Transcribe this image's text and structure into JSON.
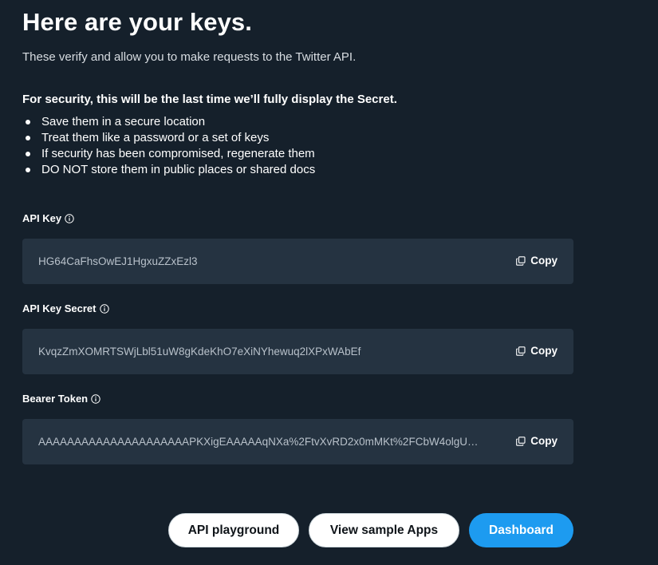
{
  "header": {
    "title": "Here are your keys.",
    "subtitle": "These verify and allow you to make requests to the Twitter API."
  },
  "security": {
    "heading": "For security, this will be the last time we’ll fully display the Secret.",
    "tips": [
      "Save them in a secure location",
      "Treat them like a password or a set of keys",
      "If security has been compromised, regenerate them",
      "DO NOT store them in public places or shared docs"
    ]
  },
  "keys": [
    {
      "label": "API Key",
      "value": "HG64CaFhsOwEJ1HgxuZZxEzl3",
      "copy_label": "Copy"
    },
    {
      "label": "API Key Secret",
      "value": "KvqzZmXOMRTSWjLbl51uW8gKdeKhO7eXiNYhewuq2lXPxWAbEf",
      "copy_label": "Copy"
    },
    {
      "label": "Bearer Token",
      "value": "AAAAAAAAAAAAAAAAAAAAAPKXigEAAAAAqNXa%2FtvXvRD2x0mMKt%2FCbW4olgU…",
      "copy_label": "Copy"
    }
  ],
  "actions": {
    "playground_label": "API playground",
    "samples_label": "View sample Apps",
    "dashboard_label": "Dashboard"
  },
  "colors": {
    "background": "#15202b",
    "field_background": "#253341",
    "accent": "#1d9bf0"
  },
  "icons": {
    "info": "info-icon",
    "copy": "copy-icon"
  }
}
